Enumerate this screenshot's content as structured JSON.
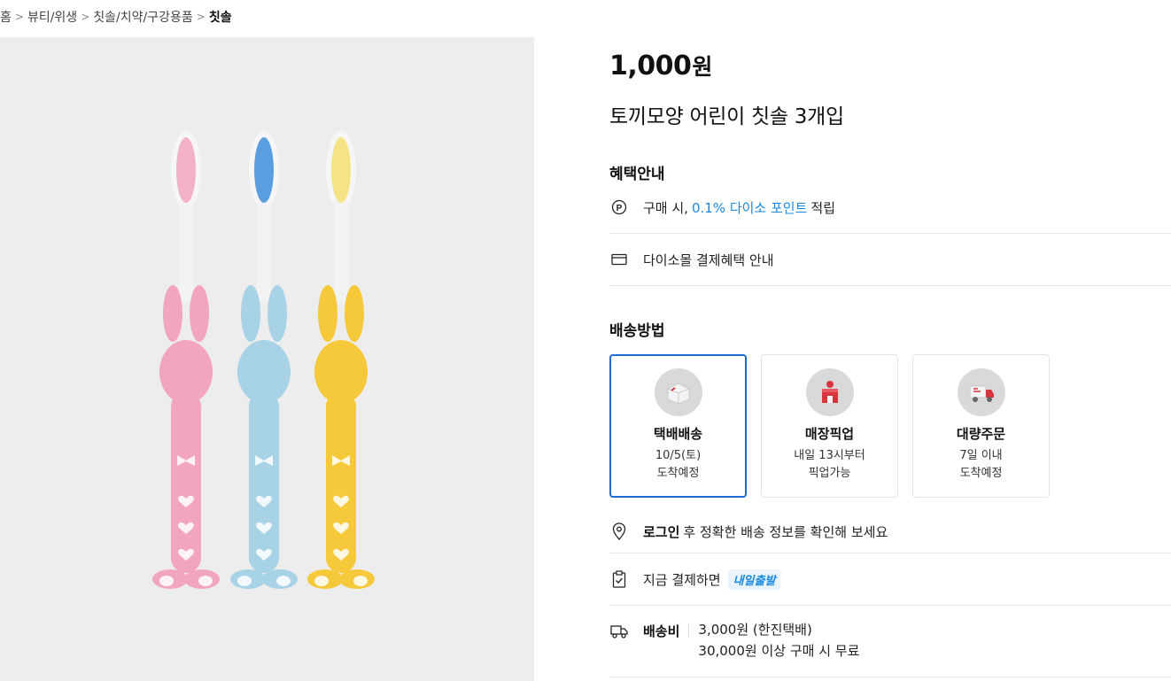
{
  "breadcrumb": {
    "items": [
      "홈",
      "뷰티/위생",
      "칫솔/치약/구강용품"
    ],
    "current": "칫솔",
    "separator": ">"
  },
  "product": {
    "price_number": "1,000",
    "price_unit": "원",
    "title": "토끼모양 어린이 칫솔 3개입",
    "colors": {
      "pink": "#f2a6bd",
      "blue": "#a8d2e6",
      "yellow": "#f6c93a"
    }
  },
  "benefits": {
    "heading": "혜택안내",
    "point_prefix": "구매 시,",
    "point_highlight": "0.1% 다이소 포인트",
    "point_suffix": "적립",
    "payment_info": "다이소몰 결제혜택 안내"
  },
  "shipping": {
    "heading": "배송방법",
    "options": [
      {
        "name": "택배배송",
        "line1": "10/5(토)",
        "line2": "도착예정",
        "selected": true
      },
      {
        "name": "매장픽업",
        "line1": "내일 13시부터",
        "line2": "픽업가능",
        "selected": false
      },
      {
        "name": "대량주문",
        "line1": "7일 이내",
        "line2": "도착예정",
        "selected": false
      }
    ],
    "login_bold": "로그인",
    "login_rest": "후 정확한 배송 정보를 확인해 보세요",
    "now_text": "지금 결제하면",
    "now_badge": "내일출발",
    "fee_label": "배송비",
    "fee_line1": "3,000원 (한진택배)",
    "fee_line2": "30,000원 이상 구매 시 무료"
  },
  "theme": {
    "accent": "#1e6bd6",
    "link": "#1a8ae0",
    "divider": "#e5e5e5"
  }
}
